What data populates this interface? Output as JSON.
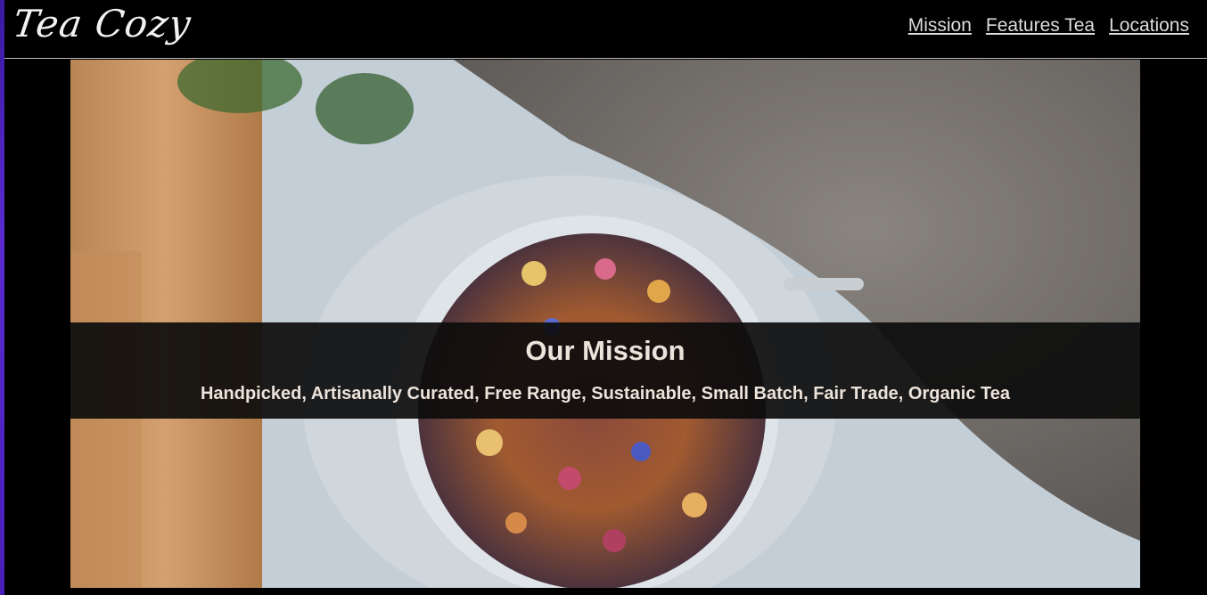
{
  "header": {
    "logo": "Tea Cozy",
    "nav": [
      {
        "label": "Mission"
      },
      {
        "label": "Features Tea"
      },
      {
        "label": "Locations"
      }
    ]
  },
  "hero": {
    "image_subject": "jar-of-loose-tea",
    "title": "Our Mission",
    "subtitle": "Handpicked, Artisanally Curated, Free Range, Sustainable, Small Batch, Fair Trade, Organic Tea"
  },
  "colors": {
    "background": "#000000",
    "nav_text": "#dcdcdc",
    "hero_text": "#ece3da",
    "accent_edge": "#4a1fb8"
  }
}
